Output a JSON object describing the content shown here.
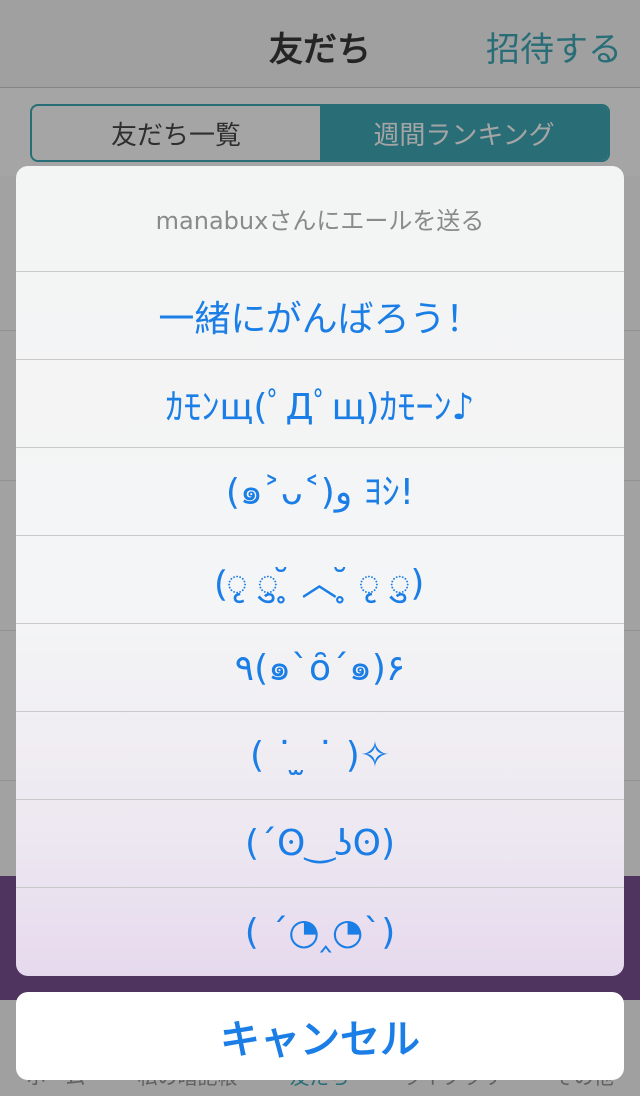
{
  "navbar": {
    "title": "友だち",
    "right_button": "招待する"
  },
  "segment": {
    "items": [
      "友だち一覧",
      "週間ランキング"
    ],
    "selected": "週間ランキング"
  },
  "tabbar": {
    "items": [
      "ホーム",
      "私の暗記帳",
      "友だち",
      "ライブラリ",
      "その他"
    ],
    "active": "友だち"
  },
  "action_sheet": {
    "title": "manabuxさんにエールを送る",
    "options": [
      "一緒にがんばろう！",
      "ｶﾓﾝщ(ﾟДﾟщ)ｶﾓｰﾝ♪",
      "(๑˃ᴗ˂)ﻭ ﾖｼ!",
      "(ृ ु ̥̆ ︿ ̥̆ ृ ु)",
      "٩(๑`ȏ´๑)۶",
      "( ˙̇ ̫ ˙̇ )✧",
      "(´ʘ‿ʖʘ)",
      "( ´◔‸◔`)"
    ],
    "cancel": "キャンセル"
  },
  "colors": {
    "accent": "#2aa0b0",
    "action_blue": "#1a7ee6",
    "purple_band": "#6a3d87"
  }
}
